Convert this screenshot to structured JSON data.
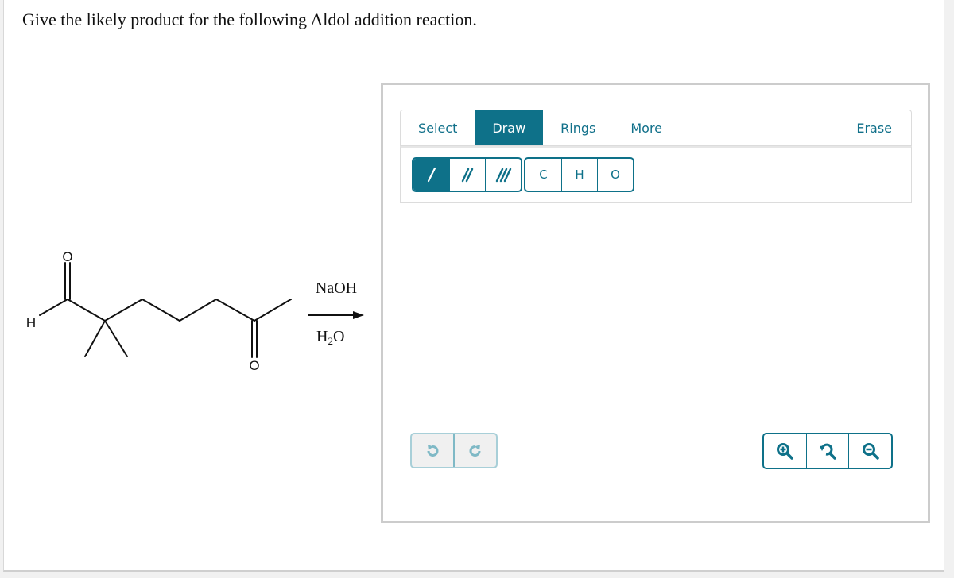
{
  "question": {
    "text": "Give the likely product for the following Aldol addition reaction."
  },
  "reaction": {
    "reactant_atom_labels": {
      "aldehyde_oxygen": "O",
      "aldehyde_hydrogen": "H",
      "ketone_oxygen": "O"
    },
    "reagent_above_arrow": "NaOH",
    "reagent_below_arrow": {
      "prefix": "H",
      "subscript": "2",
      "suffix": "O"
    }
  },
  "editor": {
    "tabs": [
      {
        "label": "Select",
        "active": false
      },
      {
        "label": "Draw",
        "active": true
      },
      {
        "label": "Rings",
        "active": false
      },
      {
        "label": "More",
        "active": false
      },
      {
        "label": "Erase",
        "active": false
      }
    ],
    "bond_buttons": [
      {
        "icon": "single-bond-icon",
        "active": true
      },
      {
        "icon": "double-bond-icon",
        "active": false
      },
      {
        "icon": "triple-bond-icon",
        "active": false
      }
    ],
    "atom_buttons": [
      "C",
      "H",
      "O"
    ],
    "history_buttons": [
      {
        "icon": "undo-icon",
        "enabled": false
      },
      {
        "icon": "redo-icon",
        "enabled": false
      }
    ],
    "zoom_buttons": [
      {
        "icon": "zoom-in-icon"
      },
      {
        "icon": "reset-zoom-icon"
      },
      {
        "icon": "zoom-out-icon"
      }
    ]
  },
  "colors": {
    "accent": "#0e7189",
    "disabled_accent": "#a8cfd8",
    "frame_border": "#cccccc",
    "page_background": "#f1f1f1"
  }
}
